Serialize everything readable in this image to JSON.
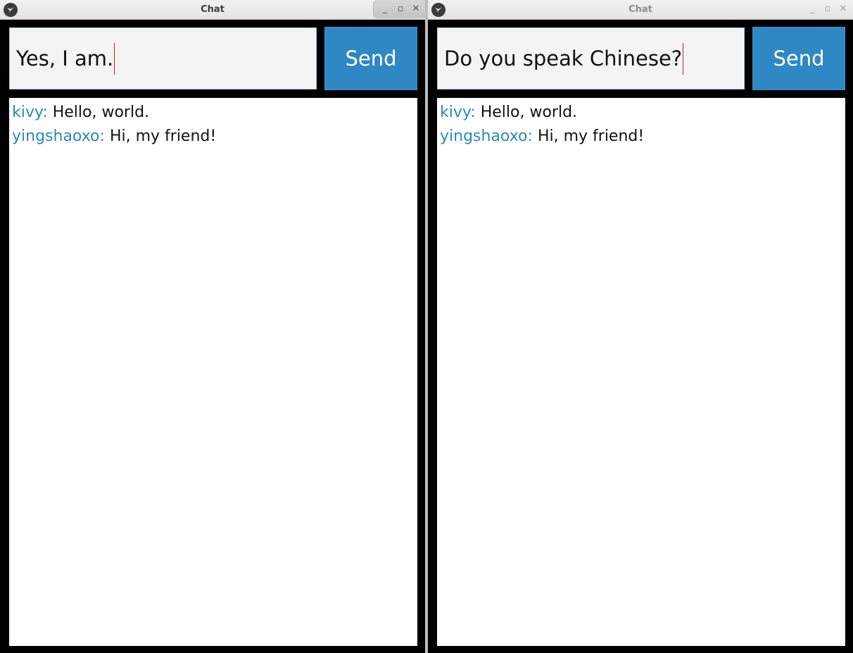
{
  "colors": {
    "accent": "#2f87c4",
    "window_background": "#000000",
    "chat_background": "#ffffff",
    "caret": "#d42020"
  },
  "windows": [
    {
      "title": "Chat",
      "focused": true,
      "controls": {
        "minimize_glyph": "_",
        "maximize_glyph": "▫",
        "close_glyph": "✕"
      },
      "input": {
        "value": "Yes, I am."
      },
      "send_label": "Send",
      "messages": [
        {
          "author": "kivy:",
          "text": "Hello, world."
        },
        {
          "author": "yingshaoxo:",
          "text": "Hi, my friend!"
        }
      ]
    },
    {
      "title": "Chat",
      "focused": false,
      "controls": {
        "minimize_glyph": "_",
        "maximize_glyph": "▫",
        "close_glyph": "✕"
      },
      "input": {
        "value": "Do you speak Chinese?"
      },
      "send_label": "Send",
      "messages": [
        {
          "author": "kivy:",
          "text": "Hello, world."
        },
        {
          "author": "yingshaoxo:",
          "text": "Hi, my friend!"
        }
      ]
    }
  ]
}
